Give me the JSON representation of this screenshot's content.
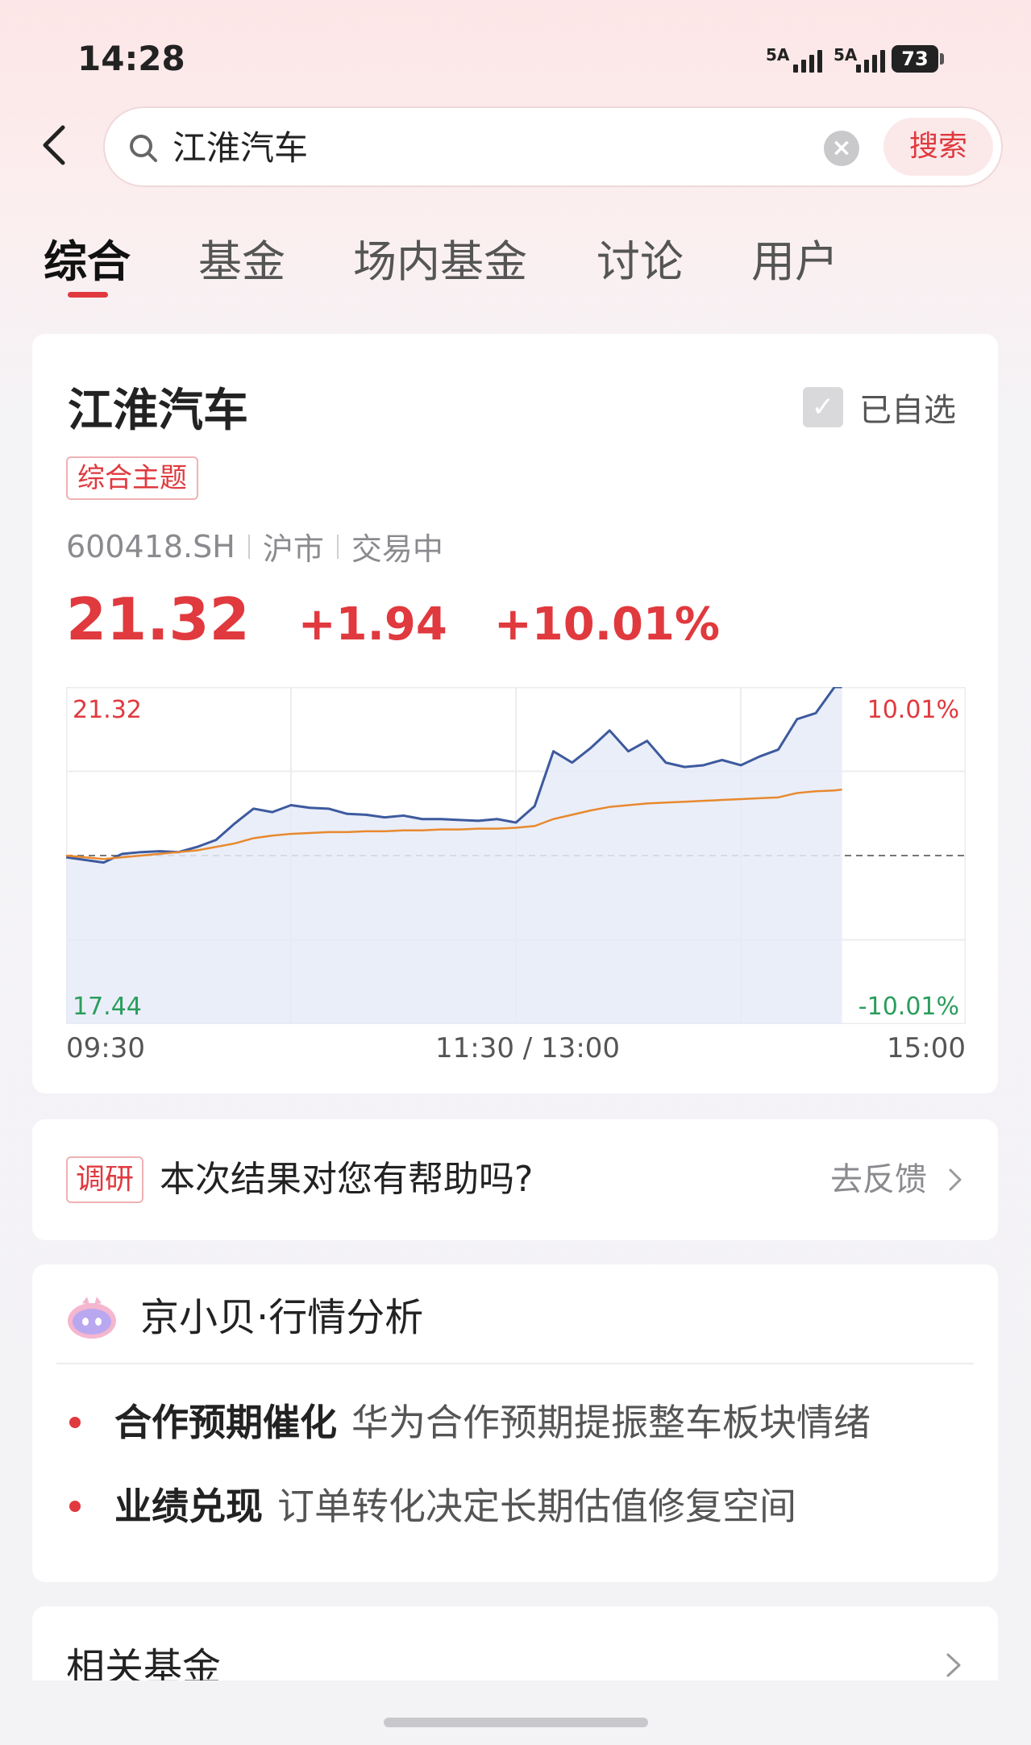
{
  "status_bar": {
    "time": "14:28",
    "signal1": "5A",
    "signal2": "5A",
    "battery": "73"
  },
  "search": {
    "query": "江淮汽车",
    "button_label": "搜索"
  },
  "tabs": [
    {
      "label": "综合",
      "active": true
    },
    {
      "label": "基金",
      "active": false
    },
    {
      "label": "场内基金",
      "active": false
    },
    {
      "label": "讨论",
      "active": false
    },
    {
      "label": "用户",
      "active": false
    }
  ],
  "stock": {
    "name": "江淮汽车",
    "watch_label": "已自选",
    "watched": true,
    "theme_tag": "综合主题",
    "code": "600418.SH",
    "market": "沪市",
    "status": "交易中",
    "price": "21.32",
    "change": "+1.94",
    "change_pct": "+10.01%",
    "up_color": "#e0393e",
    "down_color": "#2a9d5c"
  },
  "chart_data": {
    "type": "line",
    "y_top_label": "21.32",
    "y_bottom_label": "17.44",
    "pct_top_label": "10.01%",
    "pct_bottom_label": "-10.01%",
    "x_tick_labels": [
      "09:30",
      "11:30 / 13:00",
      "15:00"
    ],
    "ylim": [
      17.44,
      21.32
    ],
    "prev_close": 19.38,
    "x": [
      0,
      5,
      10,
      15,
      20,
      25,
      30,
      35,
      40,
      45,
      50,
      55,
      60,
      65,
      70,
      75,
      80,
      85,
      90,
      95,
      100,
      105,
      110,
      115,
      120,
      125,
      130,
      135,
      140,
      145,
      150,
      155,
      160,
      165,
      170,
      175,
      180,
      185,
      190,
      195,
      200,
      205,
      207
    ],
    "series": [
      {
        "color": "#3d5a9e",
        "values": [
          19.36,
          19.33,
          19.3,
          19.4,
          19.42,
          19.43,
          19.42,
          19.48,
          19.56,
          19.75,
          19.92,
          19.88,
          19.96,
          19.93,
          19.92,
          19.86,
          19.85,
          19.82,
          19.84,
          19.8,
          19.8,
          19.79,
          19.78,
          19.8,
          19.76,
          19.95,
          20.58,
          20.45,
          20.62,
          20.82,
          20.58,
          20.7,
          20.45,
          20.4,
          20.42,
          20.48,
          20.42,
          20.52,
          20.6,
          20.95,
          21.02,
          21.32,
          21.32
        ]
      },
      {
        "color": "#e8892e",
        "values": [
          19.38,
          19.36,
          19.34,
          19.36,
          19.38,
          19.4,
          19.42,
          19.44,
          19.48,
          19.52,
          19.58,
          19.61,
          19.63,
          19.64,
          19.65,
          19.65,
          19.66,
          19.66,
          19.67,
          19.67,
          19.68,
          19.68,
          19.69,
          19.69,
          19.7,
          19.72,
          19.8,
          19.85,
          19.9,
          19.94,
          19.96,
          19.98,
          19.99,
          20.0,
          20.01,
          20.02,
          20.03,
          20.04,
          20.05,
          20.1,
          20.12,
          20.13,
          20.14
        ]
      }
    ],
    "x_total": 240
  },
  "feedback": {
    "tag": "调研",
    "question": "本次结果对您有帮助吗?",
    "link": "去反馈"
  },
  "analysis": {
    "title": "京小贝·行情分析",
    "points": [
      {
        "head": "合作预期催化",
        "body": "华为合作预期提振整车板块情绪"
      },
      {
        "head": "业绩兑现",
        "body": "订单转化决定长期估值修复空间"
      }
    ]
  },
  "related_funds": {
    "title": "相关基金"
  }
}
